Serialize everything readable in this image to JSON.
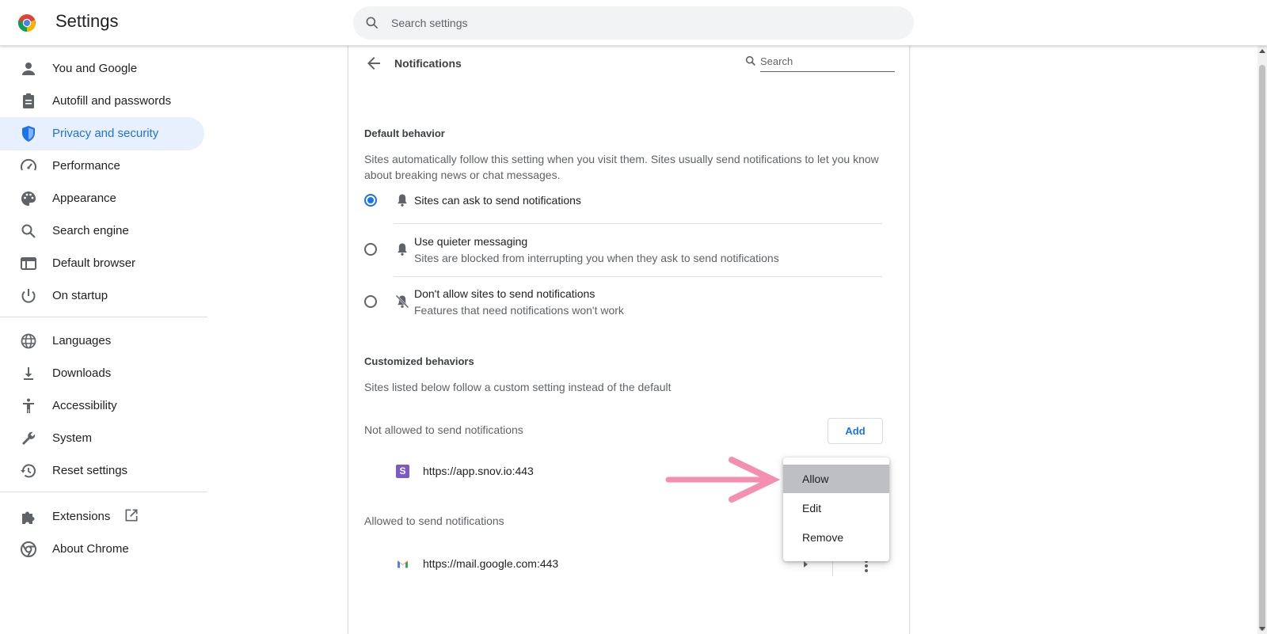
{
  "header": {
    "title": "Settings",
    "search_placeholder": "Search settings"
  },
  "sidebar": {
    "items": [
      {
        "label": "You and Google",
        "icon": "person-icon"
      },
      {
        "label": "Autofill and passwords",
        "icon": "clipboard-icon"
      },
      {
        "label": "Privacy and security",
        "icon": "shield-icon",
        "active": true
      },
      {
        "label": "Performance",
        "icon": "speedometer-icon"
      },
      {
        "label": "Appearance",
        "icon": "palette-icon"
      },
      {
        "label": "Search engine",
        "icon": "search-icon"
      },
      {
        "label": "Default browser",
        "icon": "browser-window-icon"
      },
      {
        "label": "On startup",
        "icon": "power-icon"
      },
      {
        "label": "Languages",
        "icon": "globe-icon"
      },
      {
        "label": "Downloads",
        "icon": "download-icon"
      },
      {
        "label": "Accessibility",
        "icon": "accessibility-icon"
      },
      {
        "label": "System",
        "icon": "wrench-icon"
      },
      {
        "label": "Reset settings",
        "icon": "history-icon"
      },
      {
        "label": "Extensions",
        "icon": "puzzle-icon"
      },
      {
        "label": "About Chrome",
        "icon": "chrome-icon"
      }
    ]
  },
  "page": {
    "title": "Notifications",
    "search_placeholder": "Search",
    "default_behavior": {
      "heading": "Default behavior",
      "description": "Sites automatically follow this setting when you visit them. Sites usually send notifications to let you know about breaking news or chat messages.",
      "options": [
        {
          "label": "Sites can ask to send notifications",
          "sublabel": "",
          "checked": true,
          "icon": "bell-icon"
        },
        {
          "label": "Use quieter messaging",
          "sublabel": "Sites are blocked from interrupting you when they ask to send notifications",
          "checked": false,
          "icon": "bell-icon"
        },
        {
          "label": "Don't allow sites to send notifications",
          "sublabel": "Features that need notifications won't work",
          "checked": false,
          "icon": "bell-off-icon"
        }
      ]
    },
    "customized": {
      "heading": "Customized behaviors",
      "description": "Sites listed below follow a custom setting instead of the default",
      "not_allowed": {
        "label": "Not allowed to send notifications",
        "add_label": "Add",
        "sites": [
          {
            "url": "https://app.snov.io:443",
            "favicon": "S"
          }
        ]
      },
      "allowed": {
        "label": "Allowed to send notifications",
        "sites": [
          {
            "url": "https://mail.google.com:443",
            "favicon": "M"
          }
        ]
      }
    }
  },
  "menu": {
    "items": [
      "Allow",
      "Edit",
      "Remove"
    ],
    "highlighted": "Allow"
  },
  "colors": {
    "accent": "#1a73e8",
    "active_nav_bg": "#e8f0fe",
    "annotation_arrow": "#f48fb1",
    "snov_purple": "#7b5cc7"
  }
}
